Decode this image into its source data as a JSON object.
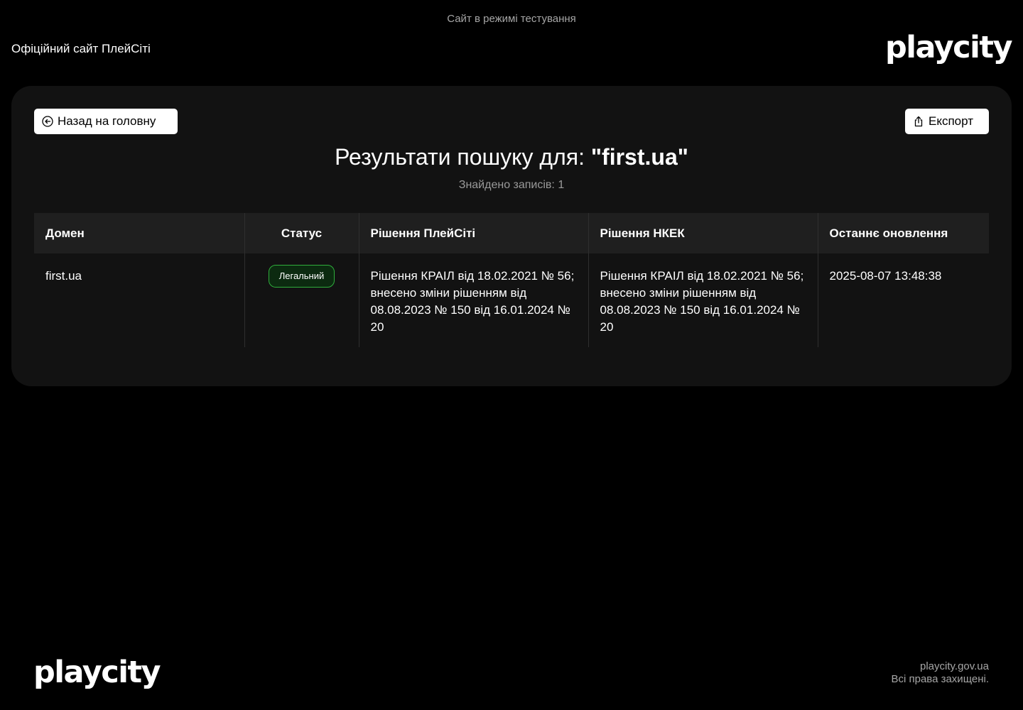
{
  "banner": "Сайт в режимі тестування",
  "header": {
    "site_label": "Офіційний сайт ПлейСіті",
    "logo": "playcity"
  },
  "toolbar": {
    "back_label": "Назад на головну",
    "back_icon": "arrow-left-circle-icon",
    "export_label": "Експорт",
    "export_icon": "share-export-icon"
  },
  "results": {
    "title_prefix": "Результати пошуку для: ",
    "query": "\"first.ua\"",
    "count_text": "Знайдено записів: 1"
  },
  "table": {
    "columns": [
      "Домен",
      "Статус",
      "Рішення ПлейСіті",
      "Рішення НКЕК",
      "Останнє оновлення"
    ],
    "rows": [
      {
        "domain": "first.ua",
        "status": "Легальний",
        "playcity_decision": "Рішення КРАІЛ від 18.02.2021 № 56; внесено зміни рішенням від 08.08.2023 № 150 від 16.01.2024 № 20",
        "nkek_decision": "Рішення КРАІЛ від 18.02.2021 № 56; внесено зміни рішенням від 08.08.2023 № 150 від 16.01.2024 № 20",
        "updated": "2025-08-07 13:48:38"
      }
    ]
  },
  "footer": {
    "logo": "playcity",
    "domain": "playcity.gov.ua",
    "rights": "Всі права захищені."
  },
  "colors": {
    "background": "#000000",
    "card": "#121212",
    "header_row": "#1f1f1f",
    "badge_border": "#2fae3c"
  }
}
